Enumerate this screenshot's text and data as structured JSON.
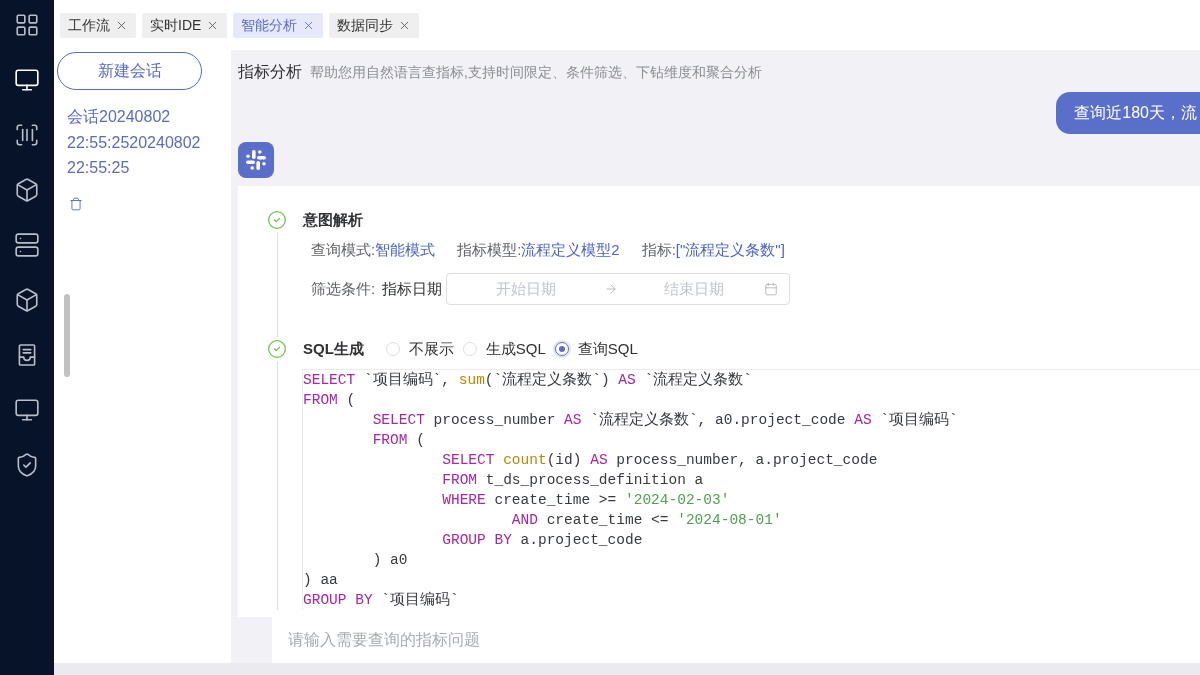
{
  "sidebar": {
    "items": [
      {
        "selected": false
      },
      {
        "selected": true
      },
      {
        "selected": false
      },
      {
        "selected": false
      },
      {
        "selected": false
      },
      {
        "selected": false
      },
      {
        "selected": false
      },
      {
        "selected": false
      },
      {
        "selected": false
      }
    ]
  },
  "tabs": [
    {
      "label": "工作流",
      "selected": false
    },
    {
      "label": "实时IDE",
      "selected": false
    },
    {
      "label": "智能分析",
      "selected": true
    },
    {
      "label": "数据同步",
      "selected": false
    }
  ],
  "sessions": {
    "new_button": "新建会话",
    "items": [
      {
        "title": "会话20240802 22:55:2520240802 22:55:25"
      }
    ]
  },
  "header": {
    "title": "指标分析",
    "subtitle": "帮助您用自然语言查指标,支持时间限定、条件筛选、下钻维度和聚合分析"
  },
  "user_message": {
    "text": "查询近180天，流"
  },
  "answer": {
    "steps": [
      {
        "kind": "intent",
        "title": "意图解析",
        "done": true,
        "fields": [
          {
            "label": "查询模式:",
            "value": "智能模式"
          },
          {
            "label": "指标模型:",
            "value": "流程定义模型2"
          },
          {
            "label": "指标:",
            "value": "[\"流程定义条数\"]"
          }
        ],
        "filter": {
          "label": "筛选条件:",
          "field": "指标日期",
          "start_placeholder": "开始日期",
          "end_placeholder": "结束日期"
        }
      },
      {
        "kind": "sql",
        "title": "SQL生成",
        "done": true,
        "options": [
          {
            "label": "不展示",
            "selected": false
          },
          {
            "label": "生成SQL",
            "selected": false
          },
          {
            "label": "查询SQL",
            "selected": true
          }
        ],
        "code": [
          [
            {
              "kind": "keyword",
              "text": "SELECT"
            },
            {
              "kind": "plain",
              "text": " `项目编码`, "
            },
            {
              "kind": "function",
              "text": "sum"
            },
            {
              "kind": "plain",
              "text": "(`流程定义条数`) "
            },
            {
              "kind": "keyword",
              "text": "AS"
            },
            {
              "kind": "plain",
              "text": " `流程定义条数`"
            }
          ],
          [
            {
              "kind": "keyword",
              "text": "FROM"
            },
            {
              "kind": "plain",
              "text": " ("
            }
          ],
          [
            {
              "kind": "keyword",
              "text": "        SELECT"
            },
            {
              "kind": "plain",
              "text": " process_number "
            },
            {
              "kind": "keyword",
              "text": "AS"
            },
            {
              "kind": "plain",
              "text": " `流程定义条数`, a0.project_code "
            },
            {
              "kind": "keyword",
              "text": "AS"
            },
            {
              "kind": "plain",
              "text": " `项目编码`"
            }
          ],
          [
            {
              "kind": "keyword",
              "text": "        FROM"
            },
            {
              "kind": "plain",
              "text": " ("
            }
          ],
          [
            {
              "kind": "keyword",
              "text": "                SELECT "
            },
            {
              "kind": "function",
              "text": "count"
            },
            {
              "kind": "plain",
              "text": "(id) "
            },
            {
              "kind": "keyword",
              "text": "AS"
            },
            {
              "kind": "plain",
              "text": " process_number, a.project_code"
            }
          ],
          [
            {
              "kind": "keyword",
              "text": "                FROM"
            },
            {
              "kind": "plain",
              "text": " t_ds_process_definition a"
            }
          ],
          [
            {
              "kind": "keyword",
              "text": "                WHERE"
            },
            {
              "kind": "plain",
              "text": " create_time >= "
            },
            {
              "kind": "string",
              "text": "'2024-02-03'"
            }
          ],
          [
            {
              "kind": "keyword",
              "text": "                        AND"
            },
            {
              "kind": "plain",
              "text": " create_time <= "
            },
            {
              "kind": "string",
              "text": "'2024-08-01'"
            }
          ],
          [
            {
              "kind": "keyword",
              "text": "                GROUP BY"
            },
            {
              "kind": "plain",
              "text": " a.project_code"
            }
          ],
          [
            {
              "kind": "plain",
              "text": "        ) a0"
            }
          ],
          [
            {
              "kind": "plain",
              "text": ") aa"
            }
          ],
          [
            {
              "kind": "keyword",
              "text": "GROUP BY"
            },
            {
              "kind": "plain",
              "text": " `项目编码`"
            }
          ]
        ]
      }
    ]
  },
  "input": {
    "placeholder": "请输入需要查询的指标问题"
  }
}
